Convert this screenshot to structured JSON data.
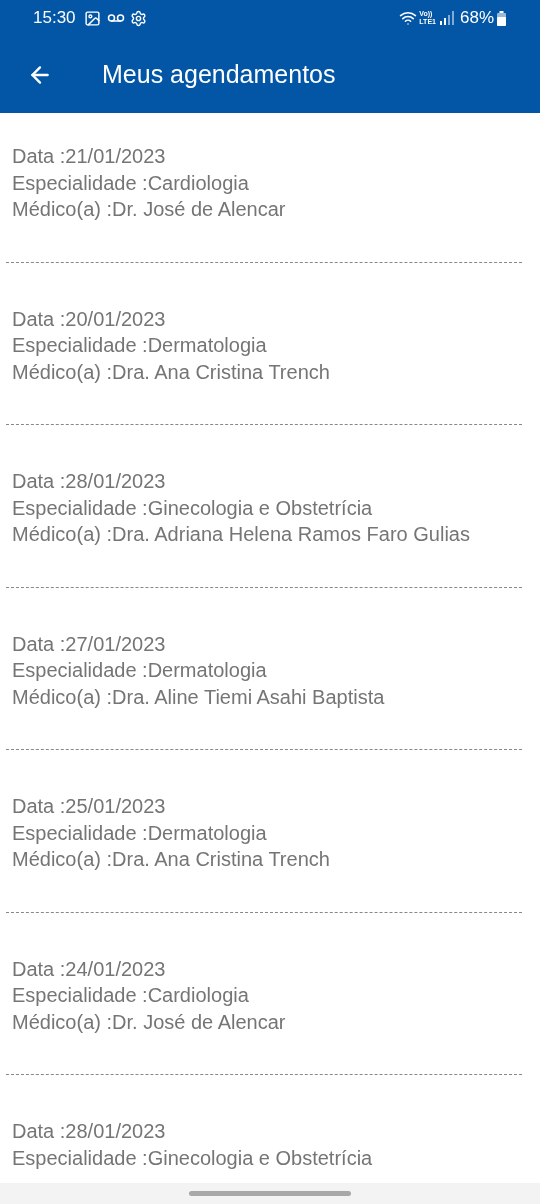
{
  "status_bar": {
    "time": "15:30",
    "network_top": "Vo))",
    "network_bottom": "LTE1",
    "battery": "68%"
  },
  "app_bar": {
    "title": "Meus agendamentos"
  },
  "appointments": [
    {
      "lines": [
        "Data :21/01/2023",
        "Especialidade :Cardiologia",
        "Médico(a) :Dr. José de Alencar"
      ]
    },
    {
      "lines": [
        "Data :20/01/2023",
        "Especialidade :Dermatologia",
        "Médico(a) :Dra. Ana Cristina Trench"
      ]
    },
    {
      "lines": [
        "Data :28/01/2023",
        "Especialidade :Ginecologia e Obstetrícia",
        "Médico(a) :Dra. Adriana Helena Ramos Faro Gulias"
      ]
    },
    {
      "lines": [
        "Data :27/01/2023",
        "Especialidade :Dermatologia",
        "Médico(a) :Dra. Aline Tiemi Asahi Baptista"
      ]
    },
    {
      "lines": [
        "Data :25/01/2023",
        "Especialidade :Dermatologia",
        "Médico(a) :Dra. Ana Cristina Trench"
      ]
    },
    {
      "lines": [
        "Data :24/01/2023",
        "Especialidade :Cardiologia",
        "Médico(a) :Dr. José de Alencar"
      ]
    },
    {
      "lines": [
        "Data :28/01/2023",
        "Especialidade :Ginecologia e Obstetrícia"
      ]
    }
  ]
}
